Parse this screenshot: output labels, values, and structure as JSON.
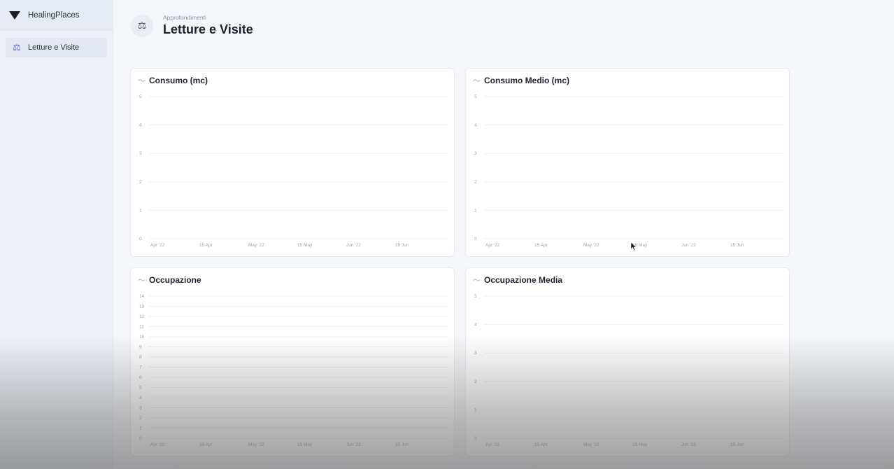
{
  "sidebar": {
    "brand": "HealingPlaces",
    "items": [
      {
        "label": "Letture e Visite",
        "icon": "scale-icon"
      }
    ]
  },
  "header": {
    "supertitle": "Approfondimenti",
    "title": "Letture e Visite",
    "icon": "scale-icon"
  },
  "chart_data": [
    {
      "type": "line",
      "title": "Consumo (mc)",
      "y_ticks": [
        "0",
        "1",
        "2",
        "3",
        "4",
        "5"
      ],
      "ylim": [
        0,
        5
      ],
      "x_ticks": [
        "Apr '22",
        "15 Apr",
        "May '22",
        "15 May",
        "Jun '22",
        "15 Jun"
      ],
      "series": [],
      "grid": true
    },
    {
      "type": "line",
      "title": "Consumo Medio (mc)",
      "y_ticks": [
        "0",
        "1",
        "2",
        "3",
        "4",
        "5"
      ],
      "ylim": [
        0,
        5
      ],
      "x_ticks": [
        "Apr '22",
        "15 Apr",
        "May '22",
        "15 May",
        "Jun '22",
        "15 Jun"
      ],
      "series": [],
      "grid": true
    },
    {
      "type": "line",
      "title": "Occupazione",
      "y_ticks": [
        "0",
        "1",
        "2",
        "3",
        "4",
        "5",
        "6",
        "7",
        "8",
        "9",
        "10",
        "11",
        "12",
        "13",
        "14"
      ],
      "ylim": [
        0,
        14
      ],
      "x_ticks": [
        "Apr '22",
        "15 Apr",
        "May '22",
        "15 May",
        "Jun '22",
        "15 Jun"
      ],
      "series": [],
      "grid": true
    },
    {
      "type": "line",
      "title": "Occupazione Media",
      "y_ticks": [
        "0",
        "1",
        "2",
        "3",
        "4",
        "5"
      ],
      "ylim": [
        0,
        5
      ],
      "x_ticks": [
        "Apr '22",
        "15 Apr",
        "May '22",
        "15 May",
        "Jun '22",
        "15 Jun"
      ],
      "series": [],
      "grid": true
    }
  ]
}
